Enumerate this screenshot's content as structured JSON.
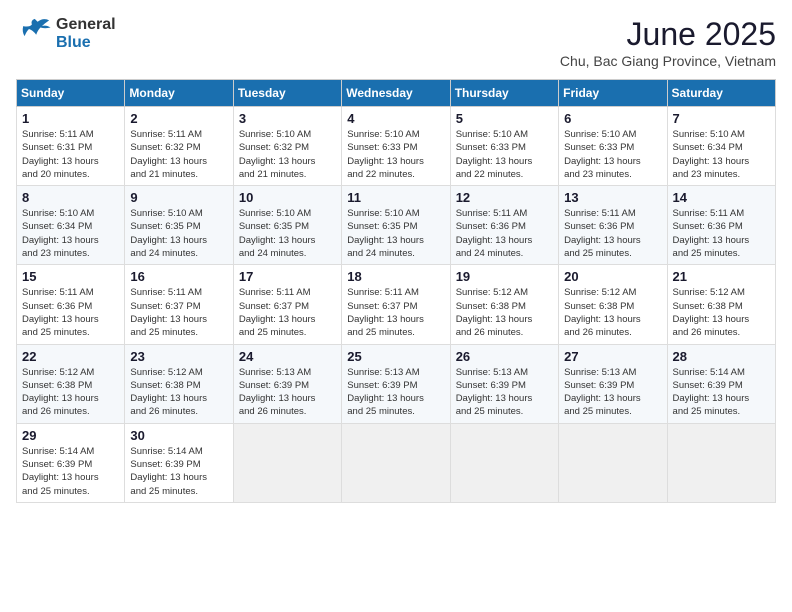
{
  "logo": {
    "general": "General",
    "blue": "Blue"
  },
  "title": {
    "month": "June 2025",
    "location": "Chu, Bac Giang Province, Vietnam"
  },
  "weekdays": [
    "Sunday",
    "Monday",
    "Tuesday",
    "Wednesday",
    "Thursday",
    "Friday",
    "Saturday"
  ],
  "weeks": [
    [
      {
        "day": "1",
        "info": "Sunrise: 5:11 AM\nSunset: 6:31 PM\nDaylight: 13 hours\nand 20 minutes."
      },
      {
        "day": "2",
        "info": "Sunrise: 5:11 AM\nSunset: 6:32 PM\nDaylight: 13 hours\nand 21 minutes."
      },
      {
        "day": "3",
        "info": "Sunrise: 5:10 AM\nSunset: 6:32 PM\nDaylight: 13 hours\nand 21 minutes."
      },
      {
        "day": "4",
        "info": "Sunrise: 5:10 AM\nSunset: 6:33 PM\nDaylight: 13 hours\nand 22 minutes."
      },
      {
        "day": "5",
        "info": "Sunrise: 5:10 AM\nSunset: 6:33 PM\nDaylight: 13 hours\nand 22 minutes."
      },
      {
        "day": "6",
        "info": "Sunrise: 5:10 AM\nSunset: 6:33 PM\nDaylight: 13 hours\nand 23 minutes."
      },
      {
        "day": "7",
        "info": "Sunrise: 5:10 AM\nSunset: 6:34 PM\nDaylight: 13 hours\nand 23 minutes."
      }
    ],
    [
      {
        "day": "8",
        "info": "Sunrise: 5:10 AM\nSunset: 6:34 PM\nDaylight: 13 hours\nand 23 minutes."
      },
      {
        "day": "9",
        "info": "Sunrise: 5:10 AM\nSunset: 6:35 PM\nDaylight: 13 hours\nand 24 minutes."
      },
      {
        "day": "10",
        "info": "Sunrise: 5:10 AM\nSunset: 6:35 PM\nDaylight: 13 hours\nand 24 minutes."
      },
      {
        "day": "11",
        "info": "Sunrise: 5:10 AM\nSunset: 6:35 PM\nDaylight: 13 hours\nand 24 minutes."
      },
      {
        "day": "12",
        "info": "Sunrise: 5:11 AM\nSunset: 6:36 PM\nDaylight: 13 hours\nand 24 minutes."
      },
      {
        "day": "13",
        "info": "Sunrise: 5:11 AM\nSunset: 6:36 PM\nDaylight: 13 hours\nand 25 minutes."
      },
      {
        "day": "14",
        "info": "Sunrise: 5:11 AM\nSunset: 6:36 PM\nDaylight: 13 hours\nand 25 minutes."
      }
    ],
    [
      {
        "day": "15",
        "info": "Sunrise: 5:11 AM\nSunset: 6:36 PM\nDaylight: 13 hours\nand 25 minutes."
      },
      {
        "day": "16",
        "info": "Sunrise: 5:11 AM\nSunset: 6:37 PM\nDaylight: 13 hours\nand 25 minutes."
      },
      {
        "day": "17",
        "info": "Sunrise: 5:11 AM\nSunset: 6:37 PM\nDaylight: 13 hours\nand 25 minutes."
      },
      {
        "day": "18",
        "info": "Sunrise: 5:11 AM\nSunset: 6:37 PM\nDaylight: 13 hours\nand 25 minutes."
      },
      {
        "day": "19",
        "info": "Sunrise: 5:12 AM\nSunset: 6:38 PM\nDaylight: 13 hours\nand 26 minutes."
      },
      {
        "day": "20",
        "info": "Sunrise: 5:12 AM\nSunset: 6:38 PM\nDaylight: 13 hours\nand 26 minutes."
      },
      {
        "day": "21",
        "info": "Sunrise: 5:12 AM\nSunset: 6:38 PM\nDaylight: 13 hours\nand 26 minutes."
      }
    ],
    [
      {
        "day": "22",
        "info": "Sunrise: 5:12 AM\nSunset: 6:38 PM\nDaylight: 13 hours\nand 26 minutes."
      },
      {
        "day": "23",
        "info": "Sunrise: 5:12 AM\nSunset: 6:38 PM\nDaylight: 13 hours\nand 26 minutes."
      },
      {
        "day": "24",
        "info": "Sunrise: 5:13 AM\nSunset: 6:39 PM\nDaylight: 13 hours\nand 26 minutes."
      },
      {
        "day": "25",
        "info": "Sunrise: 5:13 AM\nSunset: 6:39 PM\nDaylight: 13 hours\nand 25 minutes."
      },
      {
        "day": "26",
        "info": "Sunrise: 5:13 AM\nSunset: 6:39 PM\nDaylight: 13 hours\nand 25 minutes."
      },
      {
        "day": "27",
        "info": "Sunrise: 5:13 AM\nSunset: 6:39 PM\nDaylight: 13 hours\nand 25 minutes."
      },
      {
        "day": "28",
        "info": "Sunrise: 5:14 AM\nSunset: 6:39 PM\nDaylight: 13 hours\nand 25 minutes."
      }
    ],
    [
      {
        "day": "29",
        "info": "Sunrise: 5:14 AM\nSunset: 6:39 PM\nDaylight: 13 hours\nand 25 minutes."
      },
      {
        "day": "30",
        "info": "Sunrise: 5:14 AM\nSunset: 6:39 PM\nDaylight: 13 hours\nand 25 minutes."
      },
      {
        "day": "",
        "info": ""
      },
      {
        "day": "",
        "info": ""
      },
      {
        "day": "",
        "info": ""
      },
      {
        "day": "",
        "info": ""
      },
      {
        "day": "",
        "info": ""
      }
    ]
  ]
}
